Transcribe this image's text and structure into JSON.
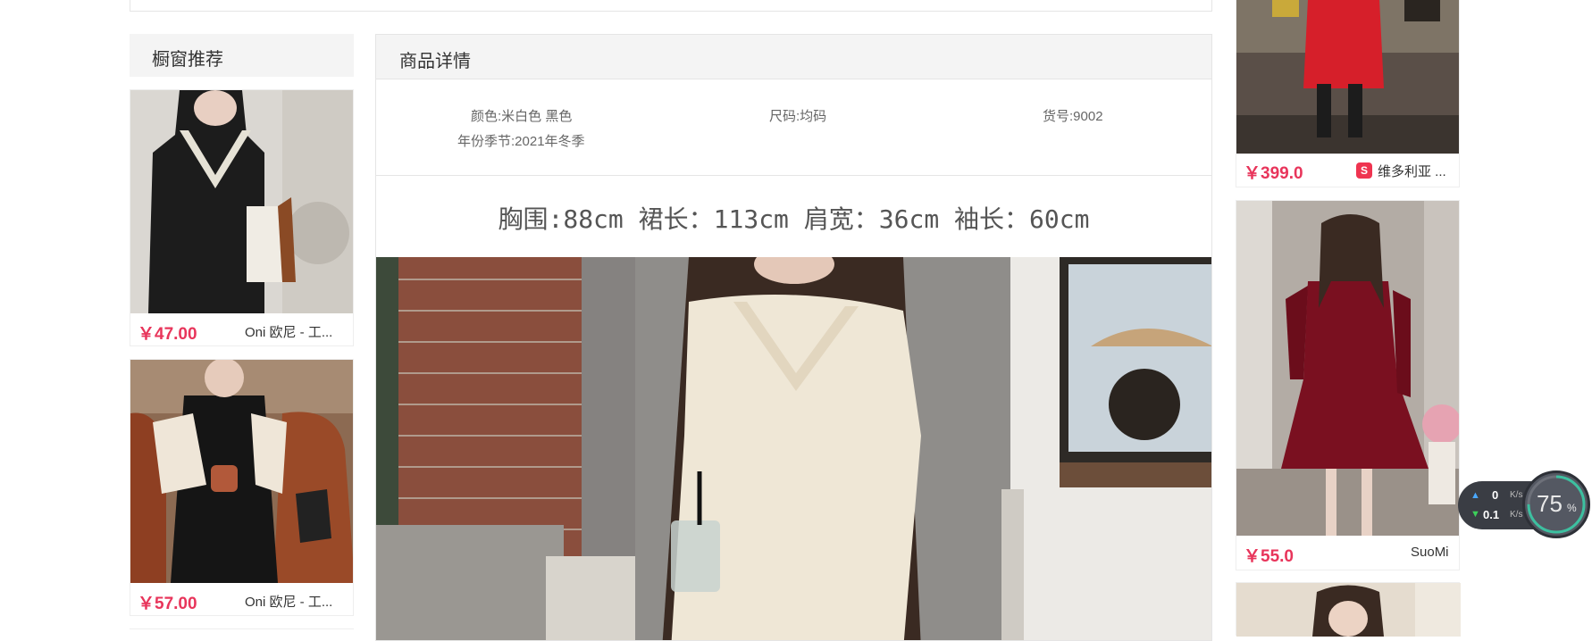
{
  "sidebar": {
    "title": "橱窗推荐",
    "items": [
      {
        "price": "￥47.00",
        "shop": "Oni 欧尼 - 工..."
      },
      {
        "price": "￥57.00",
        "shop": "Oni 欧尼 - 工..."
      }
    ]
  },
  "detail": {
    "title": "商品详情",
    "attributes": {
      "color": "颜色:米白色 黑色",
      "season": "年份季节:2021年冬季",
      "size": "尺码:均码",
      "sku": "货号:9002"
    },
    "size_line": "胸围:88cm 裙长：113cm 肩宽：36cm 袖长：60cm"
  },
  "right_column": {
    "items": [
      {
        "price": "￥399.0",
        "shop": "维多利亚 ...",
        "shop_badge": "S"
      },
      {
        "price": "￥55.0",
        "shop": "SuoMi"
      }
    ]
  },
  "network_widget": {
    "upload": "0",
    "upload_unit": "K/s",
    "download": "0.1",
    "download_unit": "K/s",
    "percent": "75",
    "percent_sign": "%"
  },
  "colors": {
    "price": "#e8355b",
    "panel_header": "#f4f4f4",
    "border": "#e5e5e5"
  },
  "icons": [
    "shop-badge-icon",
    "upload-arrow-icon",
    "download-arrow-icon"
  ]
}
